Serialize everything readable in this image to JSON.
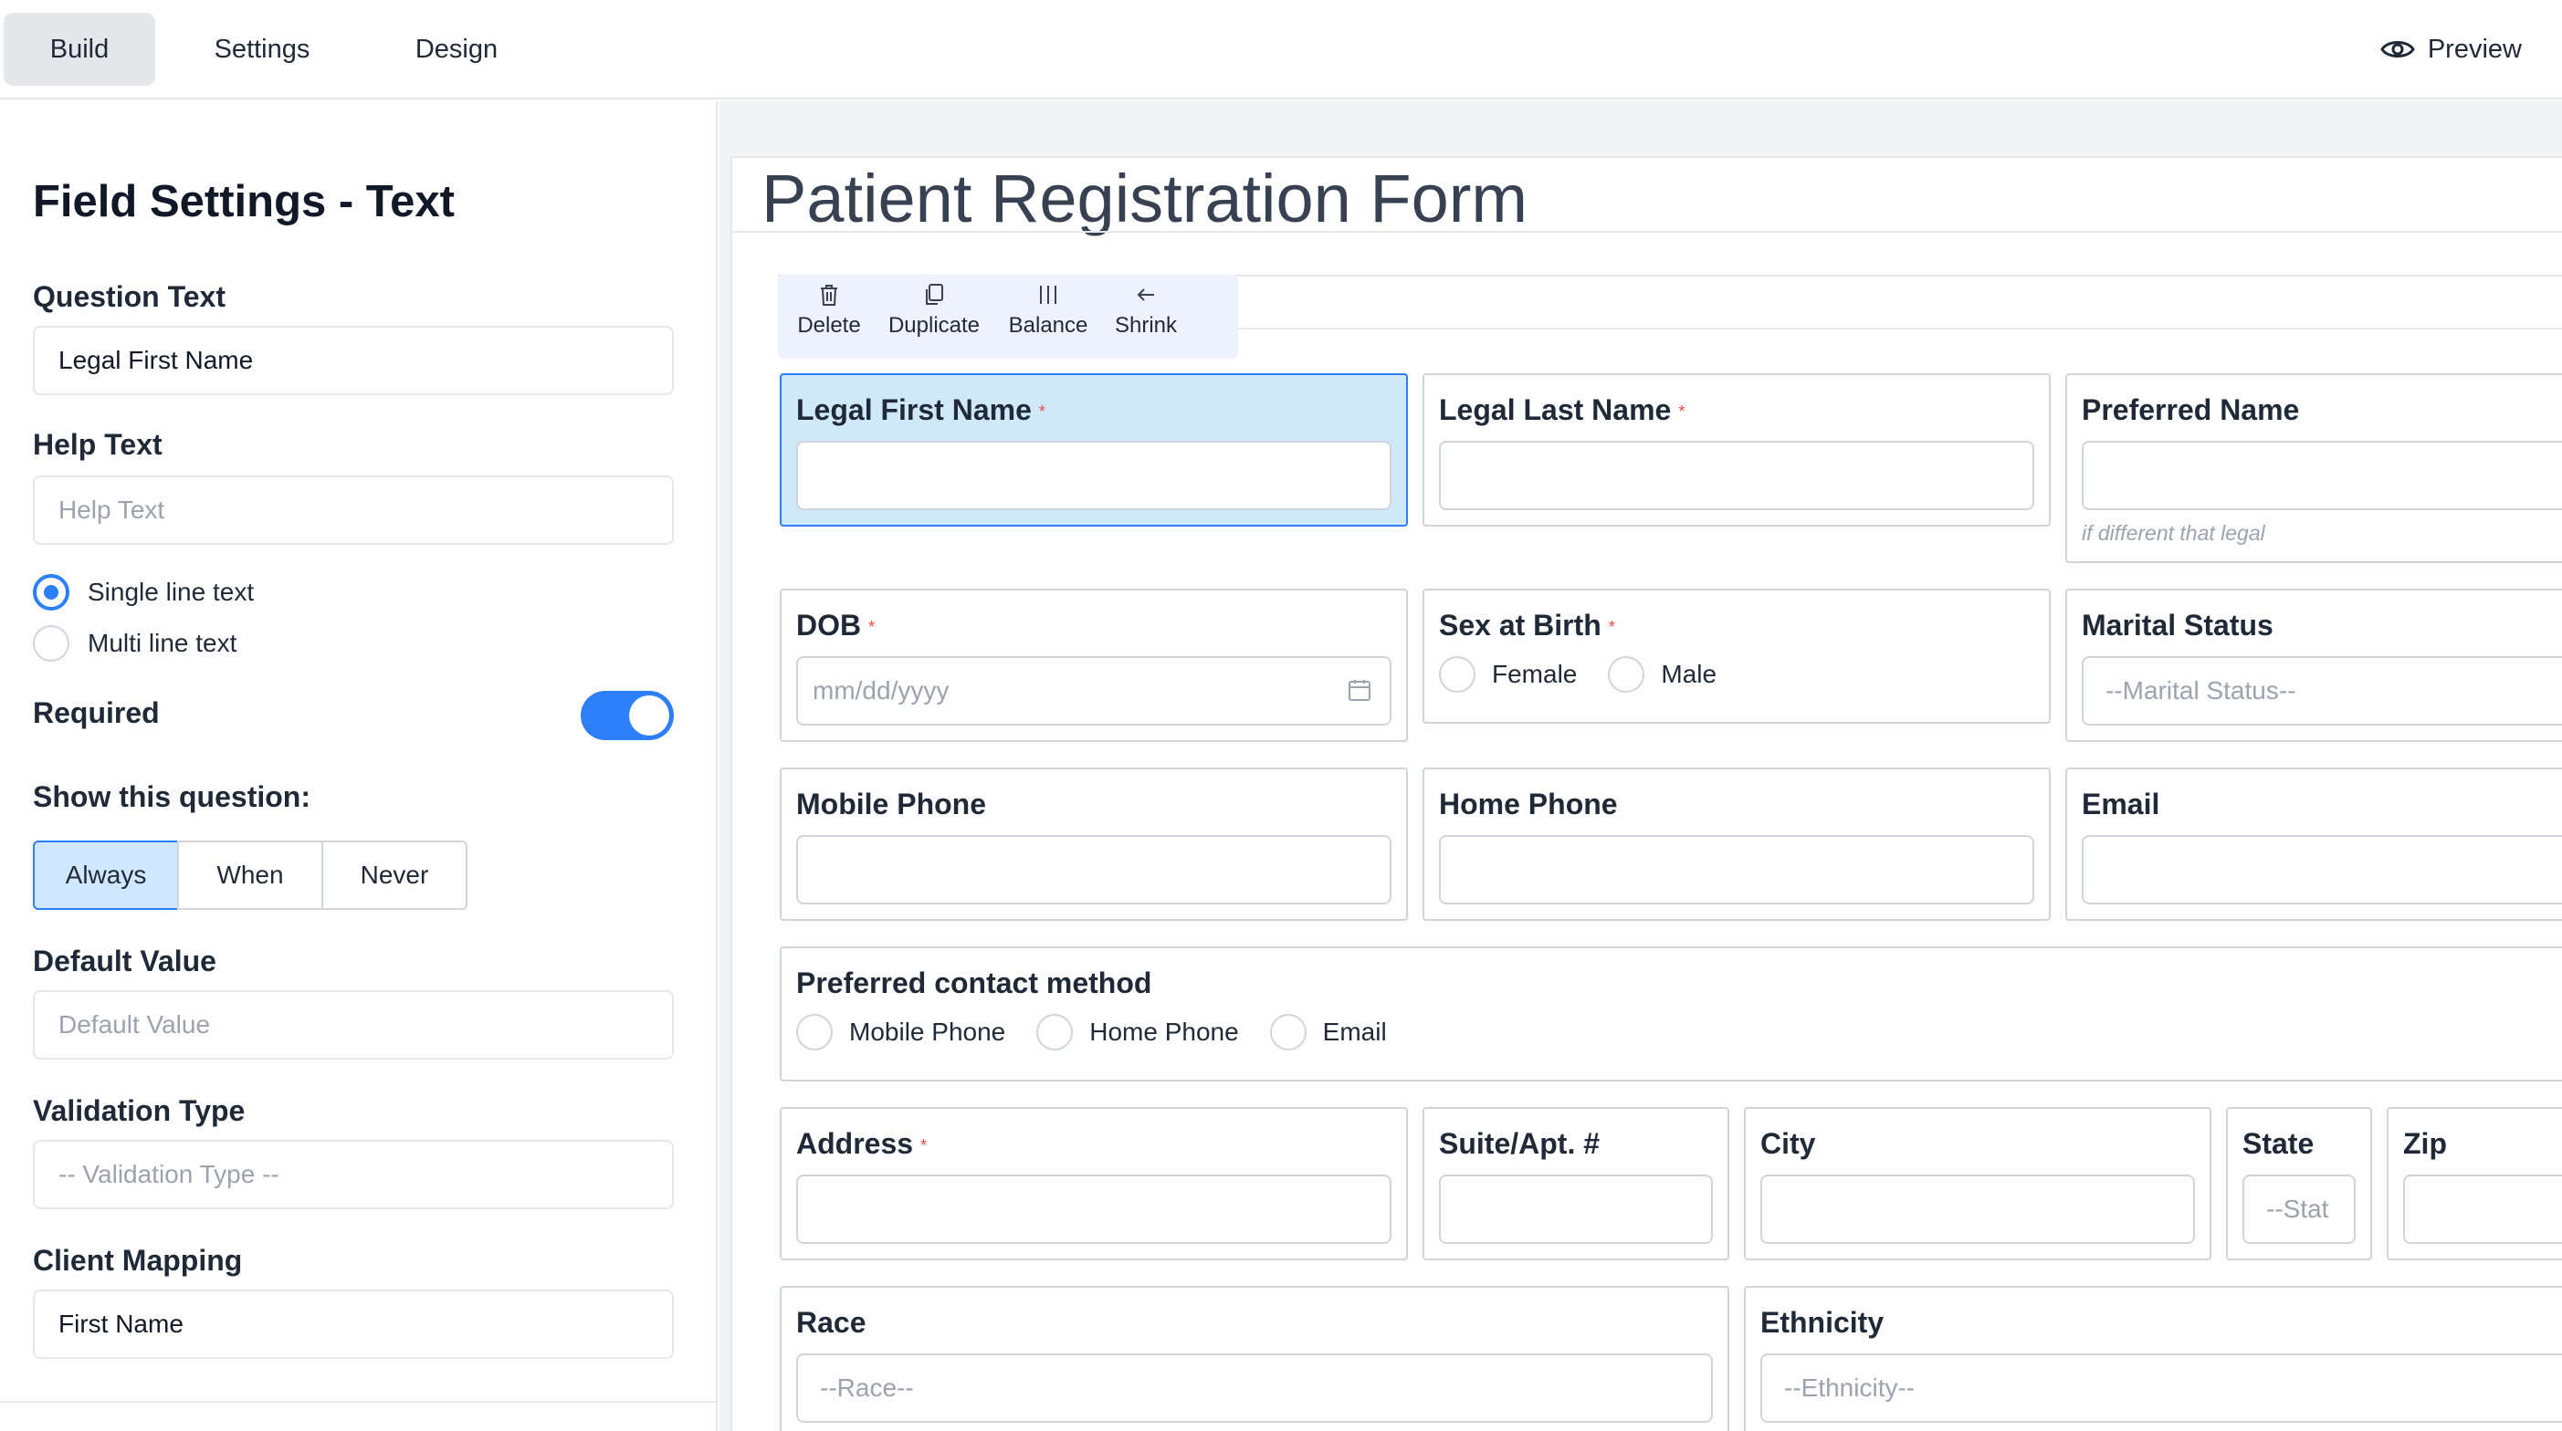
{
  "topbar": {
    "tabs": [
      {
        "label": "Build",
        "active": true
      },
      {
        "label": "Settings",
        "active": false
      },
      {
        "label": "Design",
        "active": false
      }
    ],
    "preview_label": "Preview",
    "preview_icon": "eye-icon"
  },
  "panel": {
    "title": "Field Settings - Text",
    "question_text_label": "Question Text",
    "question_text_value": "Legal First Name",
    "help_text_label": "Help Text",
    "help_text_placeholder": "Help Text",
    "line_options": [
      {
        "label": "Single line text",
        "selected": true
      },
      {
        "label": "Multi line text",
        "selected": false
      }
    ],
    "required_label": "Required",
    "required_on": true,
    "show_label": "Show this question:",
    "show_options": [
      {
        "label": "Always",
        "active": true
      },
      {
        "label": "When",
        "active": false
      },
      {
        "label": "Never",
        "active": false
      }
    ],
    "default_value_label": "Default Value",
    "default_value_placeholder": "Default Value",
    "validation_label": "Validation Type",
    "validation_placeholder": "-- Validation Type --",
    "client_mapping_label": "Client Mapping",
    "client_mapping_value": "First Name",
    "accent_color": "#2d7ff9"
  },
  "form": {
    "title": "Patient Registration Form",
    "toolbar": [
      {
        "label": "Delete",
        "icon": "trash-icon"
      },
      {
        "label": "Duplicate",
        "icon": "copy-icon"
      },
      {
        "label": "Balance",
        "icon": "columns-icon"
      },
      {
        "label": "Shrink",
        "icon": "arrow-left-icon"
      }
    ],
    "fields": {
      "legal_first_name": {
        "label": "Legal First Name",
        "required": true
      },
      "legal_last_name": {
        "label": "Legal Last Name",
        "required": true
      },
      "preferred_name": {
        "label": "Preferred Name",
        "help": "if different that legal"
      },
      "dob": {
        "label": "DOB",
        "required": true,
        "placeholder": "mm/dd/yyyy"
      },
      "sex_at_birth": {
        "label": "Sex at Birth",
        "required": true,
        "options": [
          "Female",
          "Male"
        ]
      },
      "marital_status": {
        "label": "Marital Status",
        "placeholder": "--Marital Status--"
      },
      "mobile_phone": {
        "label": "Mobile Phone"
      },
      "home_phone": {
        "label": "Home Phone"
      },
      "email": {
        "label": "Email"
      },
      "preferred_contact": {
        "label": "Preferred contact method",
        "options": [
          "Mobile Phone",
          "Home Phone",
          "Email"
        ]
      },
      "address": {
        "label": "Address",
        "required": true
      },
      "suite": {
        "label": "Suite/Apt. #"
      },
      "city": {
        "label": "City"
      },
      "state": {
        "label": "State",
        "placeholder": "--Stat"
      },
      "zip": {
        "label": "Zip"
      },
      "race": {
        "label": "Race",
        "placeholder": "--Race--"
      },
      "ethnicity": {
        "label": "Ethnicity",
        "placeholder": "--Ethnicity--"
      }
    },
    "required_mark": "*"
  }
}
